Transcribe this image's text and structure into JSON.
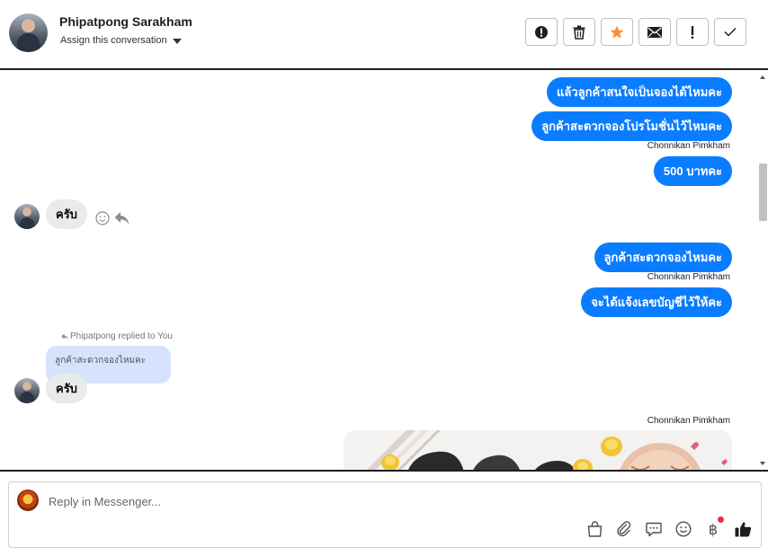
{
  "header": {
    "contact_name": "Phipatpong Sarakham",
    "assign_label": "Assign this conversation",
    "toolbar": [
      {
        "name": "report-issue-button",
        "icon": "exclamation-circle-icon"
      },
      {
        "name": "delete-button",
        "icon": "trash-icon"
      },
      {
        "name": "star-button",
        "icon": "star-icon",
        "color": "#f7923a"
      },
      {
        "name": "mark-unread-button",
        "icon": "envelope-icon"
      },
      {
        "name": "follow-up-button",
        "icon": "exclamation-icon"
      },
      {
        "name": "mark-done-button",
        "icon": "check-icon"
      }
    ]
  },
  "messages": {
    "out_1": "แล้วลูกค้าสนใจเป็นจองได้ไหมคะ",
    "out_2": "ลูกค้าสะดวกจองโปรโมชั่นไว้ไหมคะ",
    "sender_1": "Chonnikan Pimkham",
    "out_3": "500 บาทคะ",
    "in_1": "ครับ",
    "out_4": "ลูกค้าสะดวกจองไหมคะ",
    "sender_2": "Chonnikan Pimkham",
    "out_5": "จะได้แจ้งเลขบัญชีไว้ให้คะ",
    "replied_label": "Phipatpong replied to You",
    "quoted_text": "ลูกค้าสะดวกจองไหมคะ",
    "in_2": "ครับ",
    "sender_3": "Chonnikan Pimkham"
  },
  "composer": {
    "placeholder": "Reply in Messenger...",
    "tools": [
      "shopping-bag-icon",
      "paperclip-icon",
      "saved-reply-icon",
      "emoji-icon",
      "baht-payment-icon",
      "thumbs-up-icon"
    ],
    "baht_symbol": "฿"
  },
  "colors": {
    "outgoing_bubble": "#0a7cff",
    "incoming_bubble": "#e9eaeb",
    "quoted_bubble": "#d5e4fc",
    "star": "#f7923a",
    "notification_dot": "#f02849"
  }
}
